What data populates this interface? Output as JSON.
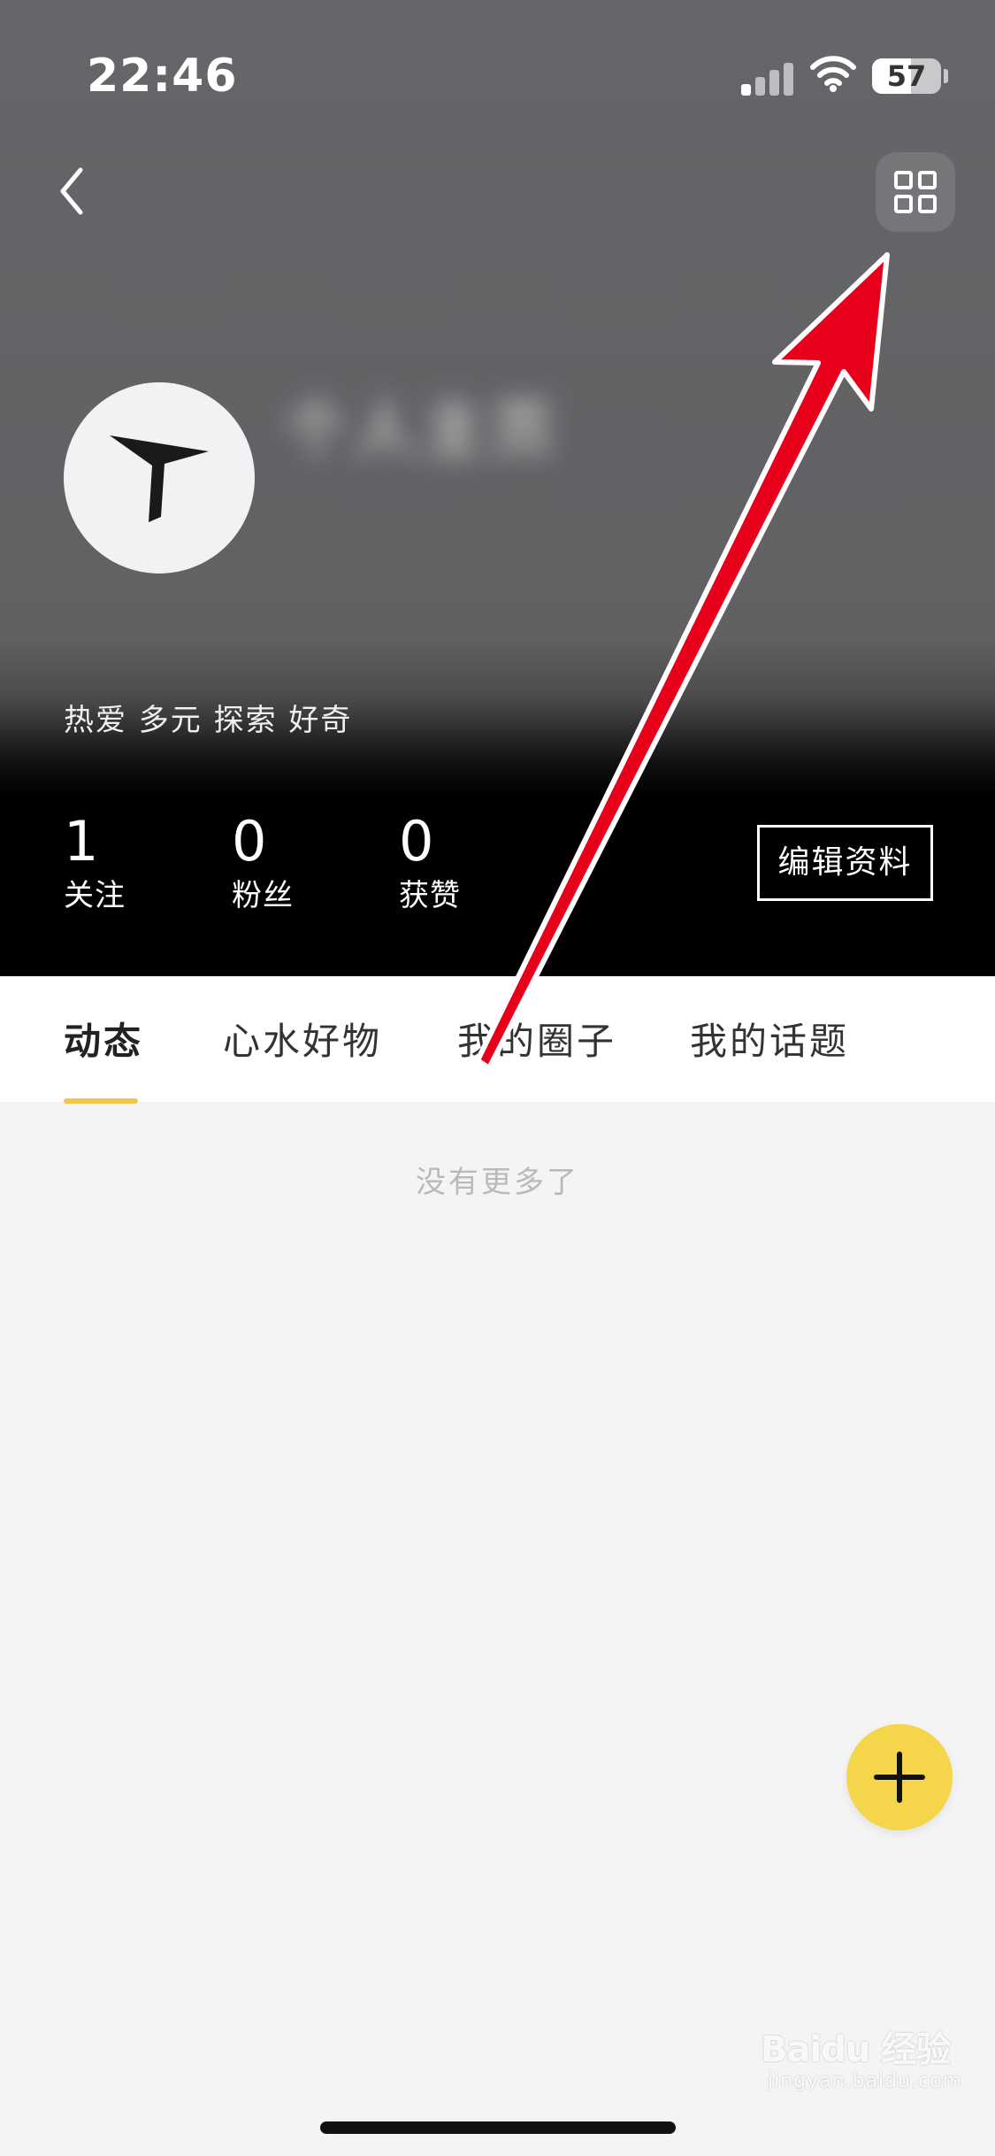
{
  "status_bar": {
    "time": "22:46",
    "battery_percent": "57",
    "battery_level": 0.57
  },
  "profile": {
    "username": "个人主页",
    "bio": "热爱 多元 探索 好奇",
    "stats": [
      {
        "value": "1",
        "label": "关注"
      },
      {
        "value": "0",
        "label": "粉丝"
      },
      {
        "value": "0",
        "label": "获赞"
      }
    ],
    "edit_label": "编辑资料"
  },
  "tabs": [
    {
      "label": "动态",
      "active": true
    },
    {
      "label": "心水好物",
      "active": false
    },
    {
      "label": "我的圈子",
      "active": false
    },
    {
      "label": "我的话题",
      "active": false
    }
  ],
  "feed": {
    "empty_text": "没有更多了"
  },
  "icons": {
    "back": "chevron-left-icon",
    "scan": "qr-code-icon",
    "fab": "plus-icon"
  },
  "watermark": {
    "logo": "Baidu 经验",
    "url": "jingyan.baidu.com"
  },
  "colors": {
    "accent": "#f3c64a",
    "fab": "#f5d54a",
    "annotation_arrow": "#e8001a"
  }
}
